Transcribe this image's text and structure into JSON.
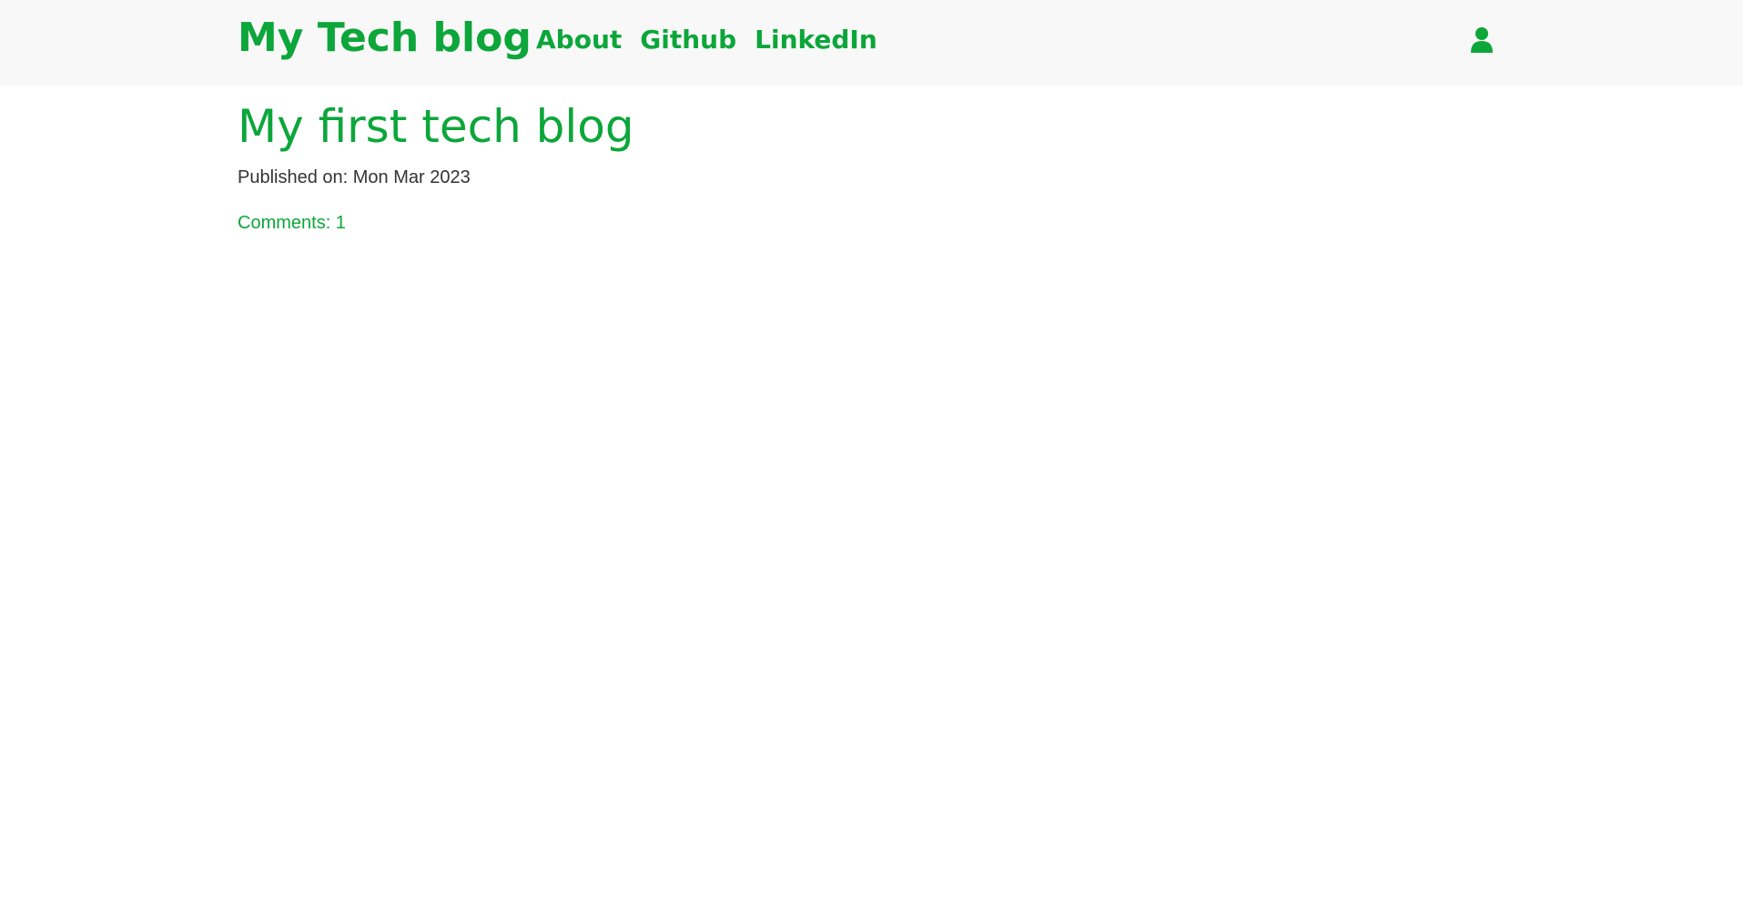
{
  "navbar": {
    "brand": "My Tech blog",
    "links": [
      {
        "label": "About"
      },
      {
        "label": "Github"
      },
      {
        "label": "LinkedIn"
      }
    ],
    "user_icon": "user-icon"
  },
  "post": {
    "title": "My first tech blog",
    "published": "Published on: Mon Mar 2023",
    "comments": "Comments: 1"
  },
  "colors": {
    "accent": "#0ca63a",
    "navbar_bg": "#f8f8f8",
    "text": "#333333"
  }
}
